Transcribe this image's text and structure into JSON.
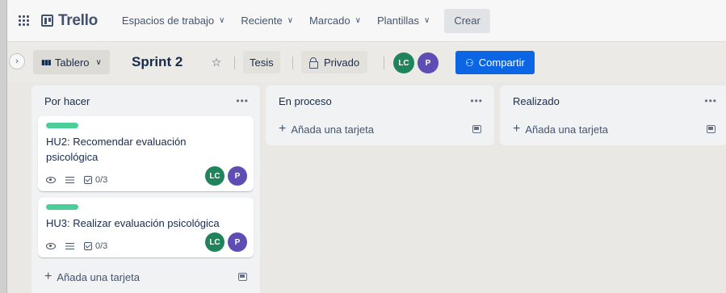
{
  "topbar": {
    "app_name": "Trello",
    "nav": [
      {
        "label": "Espacios de trabajo"
      },
      {
        "label": "Reciente"
      },
      {
        "label": "Marcado"
      },
      {
        "label": "Plantillas"
      }
    ],
    "create_label": "Crear"
  },
  "board": {
    "view_label": "Tablero",
    "title": "Sprint 2",
    "workspace_label": "Tesis",
    "visibility_label": "Privado",
    "members": [
      {
        "initials": "LC",
        "color": "#1f845a"
      },
      {
        "initials": "P",
        "color": "#5e4db2"
      }
    ],
    "share_label": "Compartir"
  },
  "lists": [
    {
      "title": "Por hacer",
      "cards": [
        {
          "label_color": "#4bce97",
          "title": "HU2: Recomendar evaluación psicológica",
          "checklist": "0/3",
          "members": [
            "LC",
            "P"
          ]
        },
        {
          "label_color": "#4bce97",
          "title": "HU3: Realizar evaluación psicológica",
          "checklist": "0/3",
          "members": [
            "LC",
            "P"
          ]
        }
      ],
      "add_card_label": "Añada una tarjeta"
    },
    {
      "title": "En proceso",
      "cards": [],
      "add_card_label": "Añada una tarjeta"
    },
    {
      "title": "Realizado",
      "cards": [],
      "add_card_label": "Añada una tarjeta"
    }
  ],
  "icons": [
    "apps-grid-icon",
    "trello-logo-icon",
    "chevron-down-icon",
    "sidebar-expand-icon",
    "board-view-icon",
    "star-icon",
    "lock-icon",
    "add-person-icon",
    "more-icon",
    "plus-icon",
    "template-icon",
    "watch-eye-icon",
    "description-icon",
    "checklist-icon"
  ]
}
